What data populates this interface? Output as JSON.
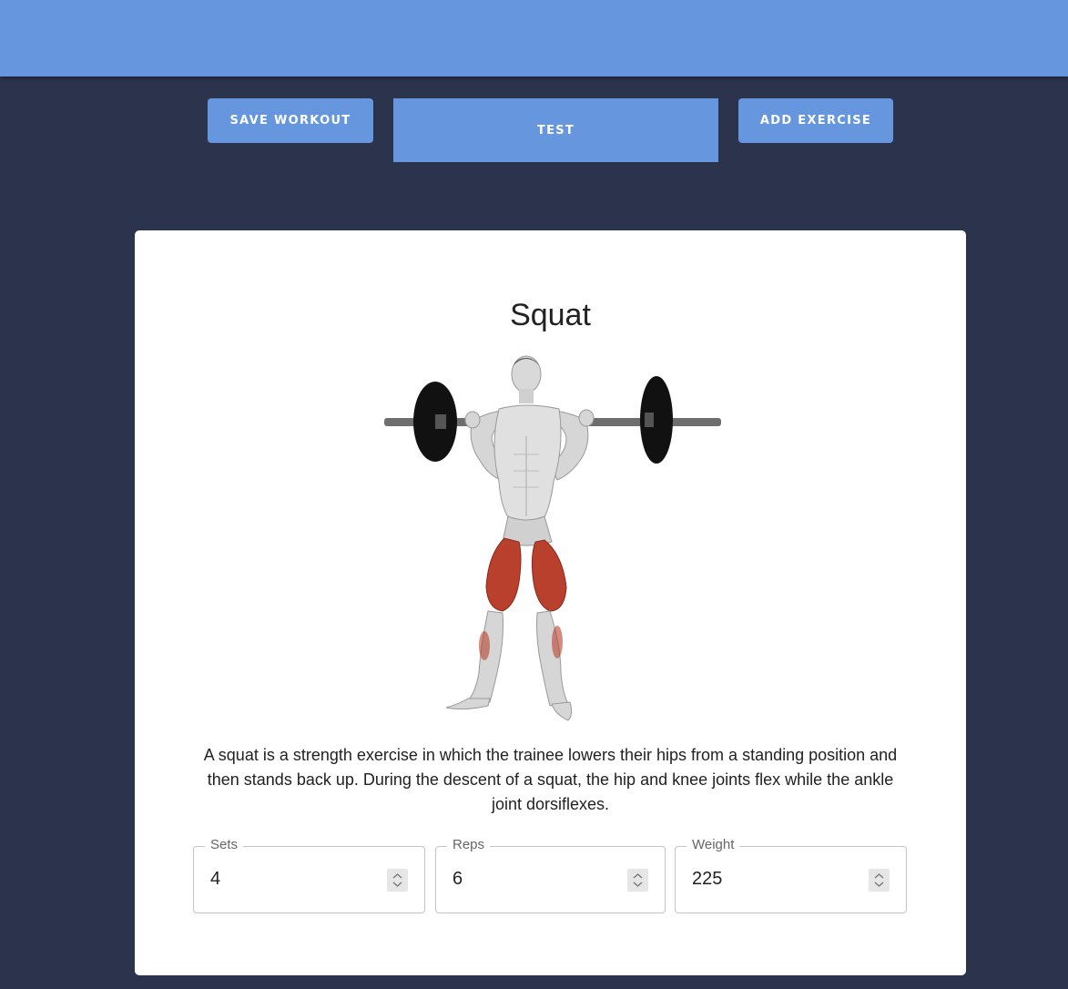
{
  "toolbar": {
    "save_label": "SAVE WORKOUT",
    "test_label": "TEST",
    "add_label": "ADD EXERCISE"
  },
  "exercise": {
    "name": "Squat",
    "image": "squat-muscle-illustration",
    "description": "A squat is a strength exercise in which the trainee lowers their hips from a standing position and then stands back up. During the descent of a squat, the hip and knee joints flex while the ankle joint dorsiflexes.",
    "fields": {
      "sets": {
        "label": "Sets",
        "value": "4"
      },
      "reps": {
        "label": "Reps",
        "value": "6"
      },
      "weight": {
        "label": "Weight",
        "value": "225"
      }
    }
  },
  "icons": {
    "spinner": "up-down-chevron-icon"
  },
  "colors": {
    "accent": "#6596de",
    "background": "#2c344d",
    "card": "#ffffff"
  }
}
